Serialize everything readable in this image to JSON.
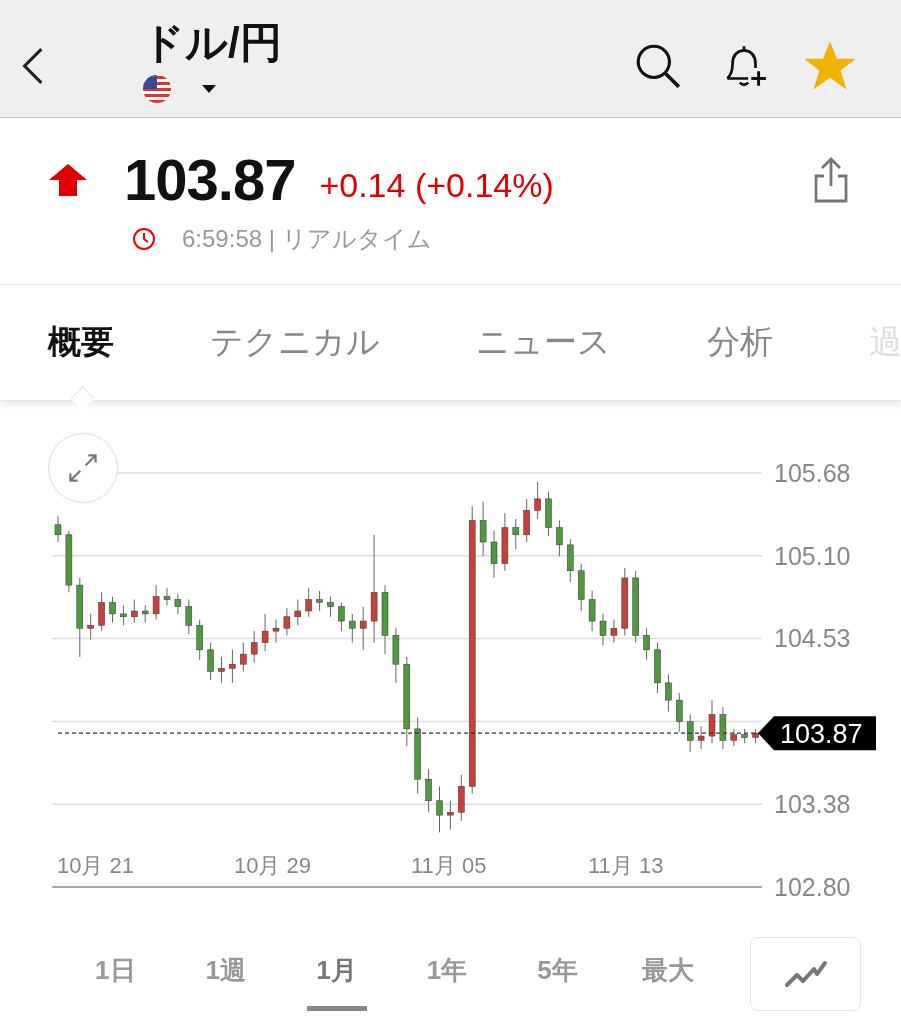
{
  "header": {
    "title": "ドル/円",
    "favorite": true
  },
  "quote": {
    "rising": true,
    "price": "103.87",
    "change": "+0.14 (+0.14%)",
    "time": "6:59:58 | リアルタイム"
  },
  "tabs": [
    {
      "label": "概要",
      "selected": true
    },
    {
      "label": "テクニカル",
      "selected": false
    },
    {
      "label": "ニュース",
      "selected": false
    },
    {
      "label": "分析",
      "selected": false
    },
    {
      "label": "過",
      "selected": false
    }
  ],
  "chart": {
    "chart_data": {
      "type": "candlestick",
      "ylim": [
        102.8,
        105.68
      ],
      "yticks": [
        {
          "value": 105.68,
          "label": "105.68"
        },
        {
          "value": 105.1,
          "label": "105.10"
        },
        {
          "value": 104.53,
          "label": "104.53"
        },
        {
          "value": 103.38,
          "label": "103.38"
        },
        {
          "value": 102.8,
          "label": "102.80"
        }
      ],
      "grid": true,
      "ref_lines": [
        {
          "axis": "y",
          "value": 103.87,
          "label": "103.87"
        }
      ],
      "ohlc": [
        [
          105.32,
          105.38,
          105.2,
          105.25
        ],
        [
          105.25,
          105.28,
          104.85,
          104.9
        ],
        [
          104.9,
          104.95,
          104.4,
          104.6
        ],
        [
          104.6,
          104.7,
          104.52,
          104.62
        ],
        [
          104.62,
          104.85,
          104.58,
          104.78
        ],
        [
          104.78,
          104.82,
          104.64,
          104.7
        ],
        [
          104.7,
          104.76,
          104.62,
          104.68
        ],
        [
          104.68,
          104.8,
          104.64,
          104.72
        ],
        [
          104.72,
          104.76,
          104.64,
          104.7
        ],
        [
          104.7,
          104.9,
          104.66,
          104.82
        ],
        [
          104.82,
          104.88,
          104.76,
          104.8
        ],
        [
          104.8,
          104.84,
          104.7,
          104.75
        ],
        [
          104.75,
          104.8,
          104.56,
          104.62
        ],
        [
          104.62,
          104.66,
          104.38,
          104.45
        ],
        [
          104.45,
          104.5,
          104.24,
          104.3
        ],
        [
          104.3,
          104.4,
          104.22,
          104.32
        ],
        [
          104.32,
          104.45,
          104.22,
          104.35
        ],
        [
          104.35,
          104.5,
          104.3,
          104.42
        ],
        [
          104.42,
          104.58,
          104.36,
          104.5
        ],
        [
          104.5,
          104.7,
          104.44,
          104.58
        ],
        [
          104.58,
          104.66,
          104.5,
          104.6
        ],
        [
          104.6,
          104.74,
          104.55,
          104.68
        ],
        [
          104.68,
          104.8,
          104.62,
          104.72
        ],
        [
          104.72,
          104.88,
          104.68,
          104.8
        ],
        [
          104.8,
          104.86,
          104.72,
          104.78
        ],
        [
          104.78,
          104.82,
          104.68,
          104.75
        ],
        [
          104.75,
          104.78,
          104.58,
          104.65
        ],
        [
          104.65,
          104.7,
          104.5,
          104.6
        ],
        [
          104.6,
          104.75,
          104.45,
          104.65
        ],
        [
          104.65,
          105.25,
          104.5,
          104.85
        ],
        [
          104.85,
          104.9,
          104.42,
          104.55
        ],
        [
          104.55,
          104.6,
          104.22,
          104.35
        ],
        [
          104.35,
          104.4,
          103.78,
          103.9
        ],
        [
          103.9,
          103.98,
          103.45,
          103.55
        ],
        [
          103.55,
          103.62,
          103.32,
          103.4
        ],
        [
          103.4,
          103.5,
          103.18,
          103.3
        ],
        [
          103.3,
          103.4,
          103.2,
          103.32
        ],
        [
          103.32,
          103.58,
          103.26,
          103.5
        ],
        [
          103.5,
          105.45,
          103.45,
          105.35
        ],
        [
          105.35,
          105.48,
          105.1,
          105.2
        ],
        [
          105.2,
          105.28,
          104.95,
          105.05
        ],
        [
          105.05,
          105.4,
          105.0,
          105.3
        ],
        [
          105.3,
          105.36,
          105.15,
          105.25
        ],
        [
          105.25,
          105.5,
          105.2,
          105.42
        ],
        [
          105.42,
          105.62,
          105.36,
          105.5
        ],
        [
          105.5,
          105.55,
          105.24,
          105.3
        ],
        [
          105.3,
          105.35,
          105.1,
          105.18
        ],
        [
          105.18,
          105.22,
          104.92,
          105.0
        ],
        [
          105.0,
          105.05,
          104.72,
          104.8
        ],
        [
          104.8,
          104.86,
          104.58,
          104.65
        ],
        [
          104.65,
          104.7,
          104.48,
          104.55
        ],
        [
          104.55,
          104.66,
          104.5,
          104.6
        ],
        [
          104.6,
          105.02,
          104.55,
          104.95
        ],
        [
          104.95,
          105.0,
          104.5,
          104.55
        ],
        [
          104.55,
          104.6,
          104.38,
          104.45
        ],
        [
          104.45,
          104.5,
          104.15,
          104.22
        ],
        [
          104.22,
          104.28,
          104.02,
          104.1
        ],
        [
          104.1,
          104.15,
          103.88,
          103.95
        ],
        [
          103.95,
          104.0,
          103.74,
          103.82
        ],
        [
          103.82,
          103.92,
          103.76,
          103.85
        ],
        [
          103.85,
          104.1,
          103.8,
          104.0
        ],
        [
          104.0,
          104.05,
          103.76,
          103.82
        ],
        [
          103.82,
          103.9,
          103.78,
          103.86
        ],
        [
          103.86,
          103.9,
          103.8,
          103.84
        ],
        [
          103.84,
          103.9,
          103.8,
          103.87
        ]
      ]
    },
    "x_labels": [
      "10月 21",
      "10月 29",
      "11月 05",
      "11月 13"
    ]
  },
  "ranges": [
    {
      "label": "1日",
      "selected": false
    },
    {
      "label": "1週",
      "selected": false
    },
    {
      "label": "1月",
      "selected": true
    },
    {
      "label": "1年",
      "selected": false
    },
    {
      "label": "5年",
      "selected": false
    },
    {
      "label": "最大",
      "selected": false
    }
  ]
}
